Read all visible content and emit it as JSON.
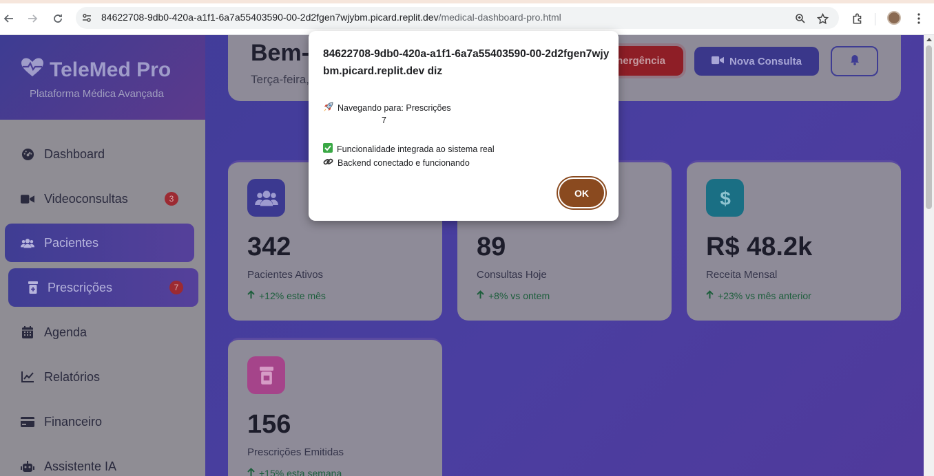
{
  "browser": {
    "url_host": "84622708-9db0-420a-a1f1-6a7a55403590-00-2d2fgen7wjybm.picard.replit.dev",
    "url_path": "/medical-dashboard-pro.html"
  },
  "sidebar": {
    "brand_title": "TeleMed Pro",
    "brand_subtitle": "Plataforma Médica Avançada",
    "items": [
      {
        "label": "Dashboard",
        "icon": "dashboard-gauge-icon"
      },
      {
        "label": "Videoconsultas",
        "icon": "video-camera-icon",
        "badge": "3"
      },
      {
        "label": "Pacientes",
        "icon": "users-icon"
      },
      {
        "label": "Prescrições",
        "icon": "prescription-bottle-icon",
        "badge": "7"
      },
      {
        "label": "Agenda",
        "icon": "calendar-icon"
      },
      {
        "label": "Relatórios",
        "icon": "line-chart-icon"
      },
      {
        "label": "Financeiro",
        "icon": "credit-card-icon"
      },
      {
        "label": "Assistente IA",
        "icon": "robot-icon"
      }
    ]
  },
  "header": {
    "greeting": "Bem-v",
    "date": "Terça-feira,",
    "emergency_label": "nergência",
    "new_consult_label": "Nova Consulta"
  },
  "stats": [
    {
      "value": "342",
      "label": "Pacientes Ativos",
      "trend": "+12% este mês",
      "icon": "users-icon",
      "color": "#3b3990"
    },
    {
      "value": "89",
      "label": "Consultas Hoje",
      "trend": "+8% vs ontem"
    },
    {
      "value": "R$ 48.2k",
      "label": "Receita Mensal",
      "trend": "+23% vs mês anterior",
      "icon": "dollar-icon",
      "color": "#1a6f84"
    },
    {
      "value": "156",
      "label": "Prescrições Emitidas",
      "trend": "+15% esta semana",
      "icon": "pill-bottle-icon",
      "color": "#a5448a"
    }
  ],
  "dialog": {
    "title": "84622708-9db0-420a-a1f1-6a7a55403590-00-2d2fgen7wjybm.picard.replit.dev diz",
    "nav_line": "Navegando para: Prescrições",
    "nav_count": "7",
    "line1": "Funcionalidade integrada ao sistema real",
    "line2": "Backend conectado e funcionando",
    "ok_label": "OK"
  }
}
